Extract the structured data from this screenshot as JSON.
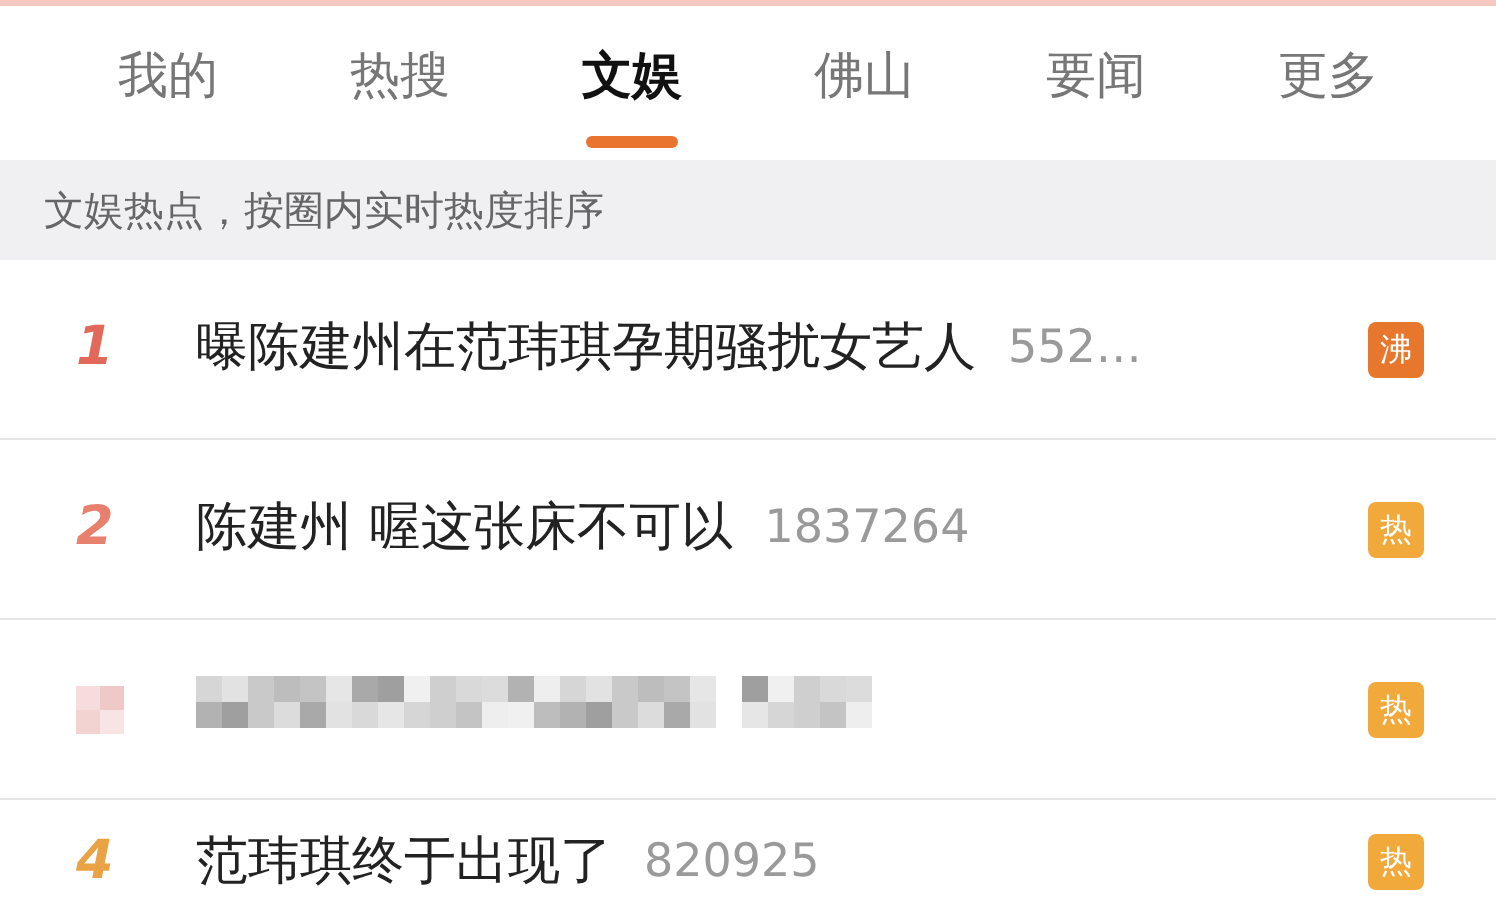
{
  "tabs": [
    {
      "label": "我的",
      "selected": false
    },
    {
      "label": "热搜",
      "selected": false
    },
    {
      "label": "文娱",
      "selected": true
    },
    {
      "label": "佛山",
      "selected": false
    },
    {
      "label": "要闻",
      "selected": false
    },
    {
      "label": "更多",
      "selected": false
    }
  ],
  "subheader": "文娱热点，按圈内实时热度排序",
  "rows": [
    {
      "kind": "item",
      "rank": {
        "text": "1",
        "color": "#e2695a"
      },
      "title": "曝陈建州在范玮琪孕期骚扰女艺人",
      "count": "552…",
      "badge": {
        "text": "沸",
        "color": "#e8772e"
      }
    },
    {
      "kind": "item",
      "rank": {
        "text": "2",
        "color": "#e8806e"
      },
      "title": "陈建州 喔这张床不可以",
      "count": "1837264",
      "badge": {
        "text": "热",
        "color": "#f2a93b"
      }
    },
    {
      "kind": "redacted",
      "badge": {
        "text": "热",
        "color": "#f2a93b"
      }
    },
    {
      "kind": "item",
      "rank": {
        "text": "4",
        "color": "#eaa344"
      },
      "title": "范玮琪终于出现了",
      "count": "820925",
      "badge": {
        "text": "热",
        "color": "#f2a93b"
      }
    }
  ]
}
